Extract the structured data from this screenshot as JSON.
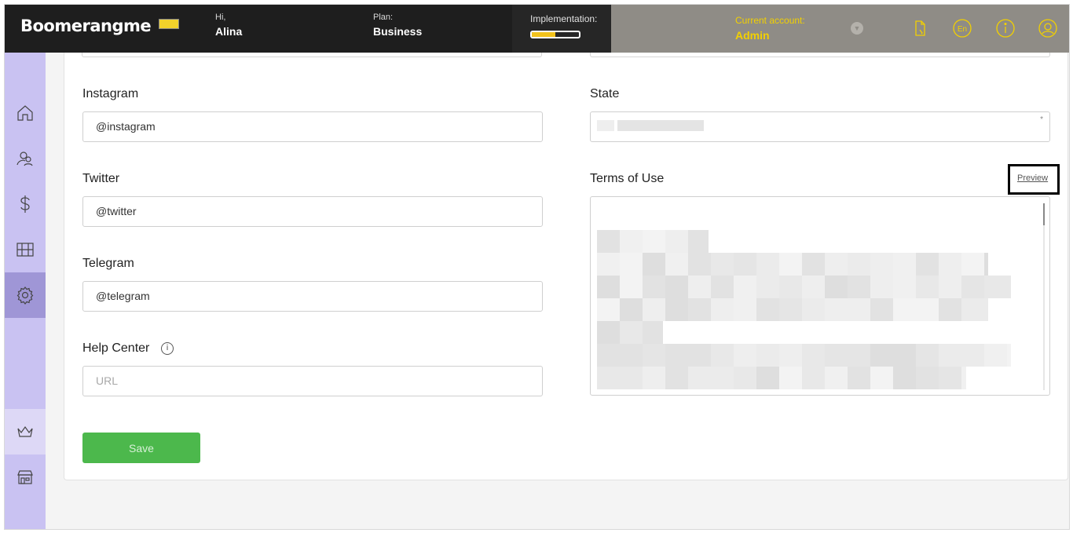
{
  "header": {
    "logo": "Boomerangme",
    "greeting_label": "Hi,",
    "user_name": "Alina",
    "plan_label": "Plan:",
    "plan_value": "Business",
    "implementation_label": "Implementation:",
    "implementation_progress": 0.5,
    "account_label": "Current account:",
    "account_value": "Admin",
    "language": "En"
  },
  "sidebar": {
    "items": [
      "home-icon",
      "customers-icon",
      "dollar-icon",
      "cards-icon",
      "settings-icon",
      "crown-icon",
      "store-icon"
    ],
    "active": "settings-icon"
  },
  "form": {
    "instagram": {
      "label": "Instagram",
      "value": "@instagram"
    },
    "twitter": {
      "label": "Twitter",
      "value": "@twitter"
    },
    "telegram": {
      "label": "Telegram",
      "value": "@telegram"
    },
    "help_center": {
      "label": "Help Center",
      "placeholder": "URL"
    },
    "state": {
      "label": "State",
      "required_mark": "*"
    },
    "terms": {
      "label": "Terms of Use",
      "preview_link": "Preview"
    },
    "save_label": "Save"
  },
  "colors": {
    "accent_yellow": "#f2d000",
    "sidebar": "#c9c2f2",
    "sidebar_active": "#9f96d6",
    "save_button": "#4cb84c"
  }
}
